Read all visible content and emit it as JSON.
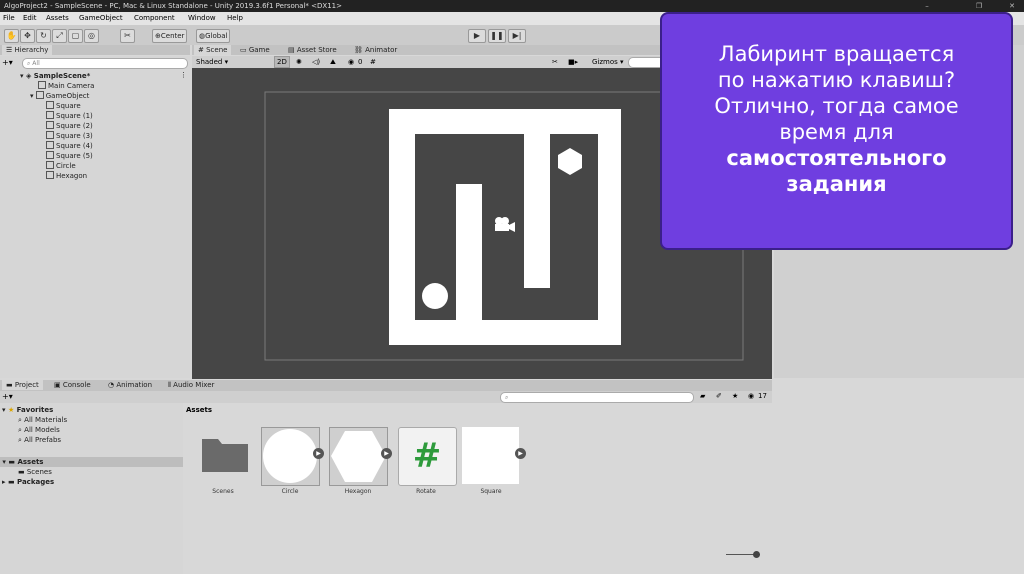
{
  "window": {
    "title": "AlgoProject2 - SampleScene - PC, Mac & Linux Standalone - Unity 2019.3.6f1 Personal* <DX11>",
    "controls": [
      "–",
      "❐",
      "✕"
    ]
  },
  "menu": [
    "File",
    "Edit",
    "Assets",
    "GameObject",
    "Component",
    "Window",
    "Help"
  ],
  "toolbar": {
    "pivot_label": "Center",
    "space_label": "Global"
  },
  "hierarchy": {
    "tab": "Hierarchy",
    "search_placeholder": "All",
    "items": [
      "SampleScene*",
      "Main Camera",
      "GameObject",
      "Square",
      "Square (1)",
      "Square (2)",
      "Square (3)",
      "Square (4)",
      "Square (5)",
      "Circle",
      "Hexagon"
    ]
  },
  "scene_tabs": [
    "Scene",
    "Game",
    "Asset Store",
    "Animator"
  ],
  "scene_toolbar": {
    "shading": "Shaded",
    "mode_2d": "2D",
    "hidden_count": "0",
    "gizmos": "Gizmos"
  },
  "bottom_tabs": [
    "Project",
    "Console",
    "Animation",
    "Audio Mixer"
  ],
  "project": {
    "favorites_label": "Favorites",
    "favorites": [
      "All Materials",
      "All Models",
      "All Prefabs"
    ],
    "assets_label": "Assets",
    "assets_children": [
      "Scenes"
    ],
    "packages_label": "Packages",
    "breadcrumb": "Assets",
    "hidden_count": "17",
    "assets": [
      {
        "name": "Scenes",
        "kind": "folder-icon"
      },
      {
        "name": "Circle",
        "kind": "circle-sprite"
      },
      {
        "name": "Hexagon",
        "kind": "hexagon-sprite"
      },
      {
        "name": "Rotate",
        "kind": "csharp-script-icon"
      },
      {
        "name": "Square",
        "kind": "square-sprite"
      }
    ],
    "script_glyph": "#"
  },
  "overlay": {
    "line1": "Лабиринт вращается",
    "line2": "по нажатию клавиш?",
    "line3": "Отлично, тогда самое",
    "line4": "время для",
    "line5": "самостоятельного",
    "line6": "задания",
    "bg_color": "#6f3ee0"
  }
}
